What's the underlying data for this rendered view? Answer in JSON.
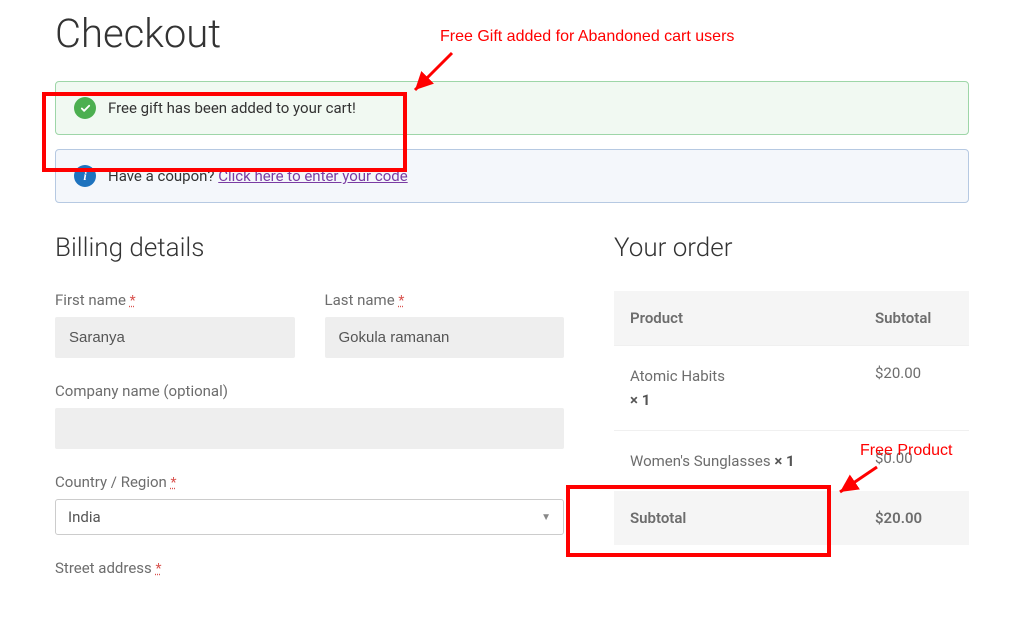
{
  "page": {
    "title": "Checkout"
  },
  "notices": {
    "success": "Free gift has been added to your cart!",
    "coupon_prompt": "Have a coupon? ",
    "coupon_link": "Click here to enter your code"
  },
  "billing": {
    "heading": "Billing details",
    "first_name_label": "First name ",
    "first_name_value": "Saranya",
    "last_name_label": "Last name ",
    "last_name_value": "Gokula ramanan",
    "company_label": "Company name (optional)",
    "company_value": "",
    "country_label": "Country / Region ",
    "country_value": "India",
    "street_label": "Street address ",
    "required_marker": "*"
  },
  "order": {
    "heading": "Your order",
    "product_header": "Product",
    "subtotal_header": "Subtotal",
    "items": [
      {
        "name": "Atomic Habits",
        "qty": "× 1",
        "price": "$20.00"
      },
      {
        "name": "Women's Sunglasses ",
        "qty": "× 1",
        "price": "$0.00"
      }
    ],
    "subtotal_label": "Subtotal",
    "subtotal_value": "$20.00"
  },
  "annotations": {
    "top_label": "Free Gift added for Abandoned cart users",
    "right_label": "Free Product"
  }
}
